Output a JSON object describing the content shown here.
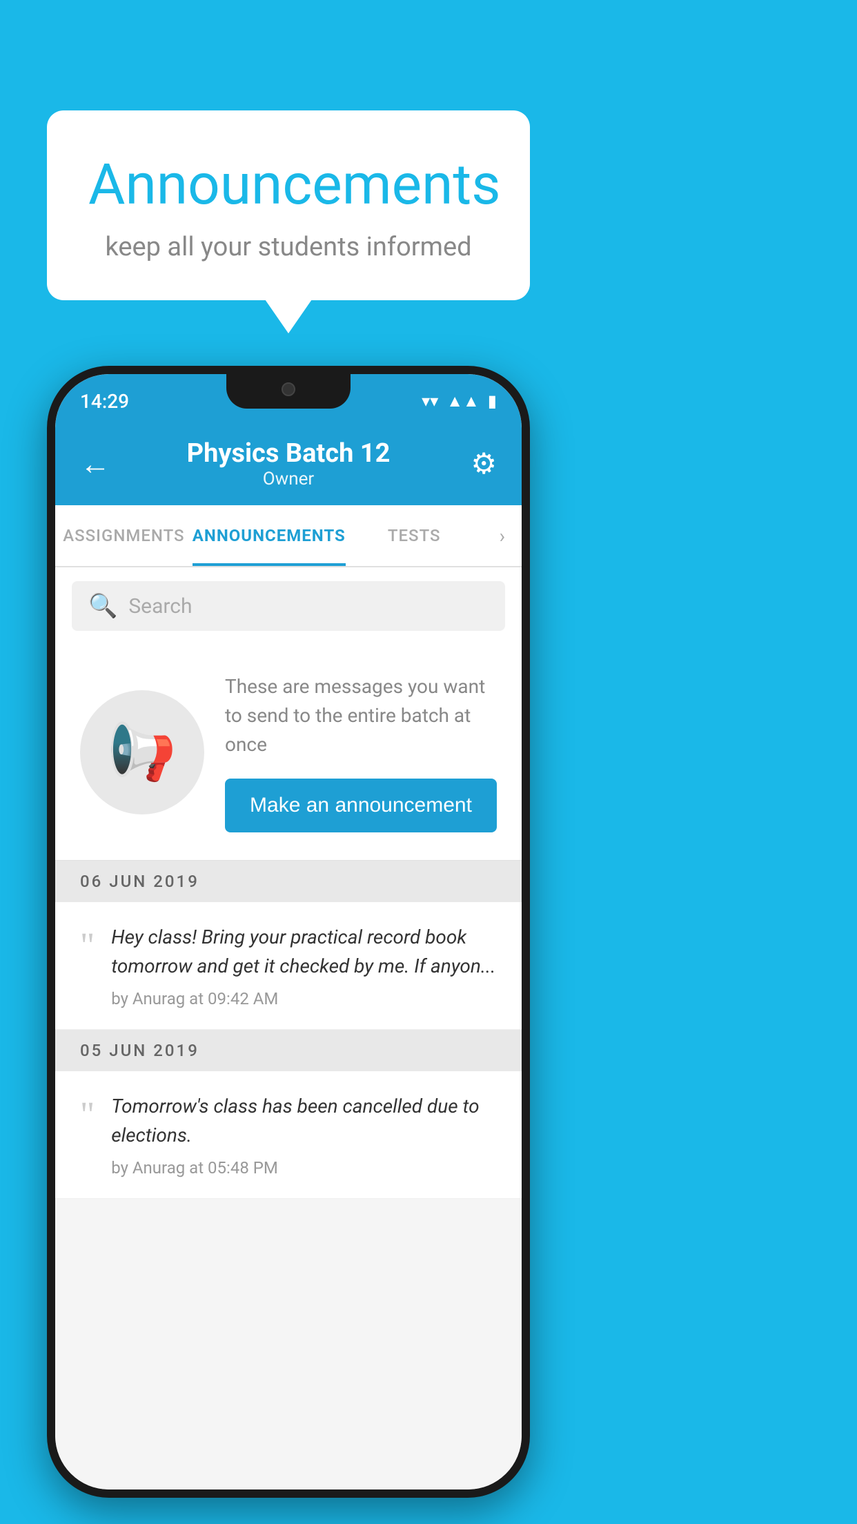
{
  "background_color": "#1ab8e8",
  "speech_bubble": {
    "title": "Announcements",
    "subtitle": "keep all your students informed"
  },
  "phone": {
    "status_bar": {
      "time": "14:29",
      "icons": [
        "wifi",
        "signal",
        "battery"
      ]
    },
    "header": {
      "title": "Physics Batch 12",
      "subtitle": "Owner",
      "back_label": "←",
      "settings_label": "⚙"
    },
    "tabs": [
      {
        "label": "ASSIGNMENTS",
        "active": false
      },
      {
        "label": "ANNOUNCEMENTS",
        "active": true
      },
      {
        "label": "TESTS",
        "active": false
      }
    ],
    "search": {
      "placeholder": "Search"
    },
    "promo": {
      "description": "These are messages you want to send to the entire batch at once",
      "button_label": "Make an announcement"
    },
    "announcements": [
      {
        "date": "06  JUN  2019",
        "items": [
          {
            "text": "Hey class! Bring your practical record book tomorrow and get it checked by me. If anyon...",
            "meta": "by Anurag at 09:42 AM"
          }
        ]
      },
      {
        "date": "05  JUN  2019",
        "items": [
          {
            "text": "Tomorrow's class has been cancelled due to elections.",
            "meta": "by Anurag at 05:48 PM"
          }
        ]
      }
    ]
  }
}
